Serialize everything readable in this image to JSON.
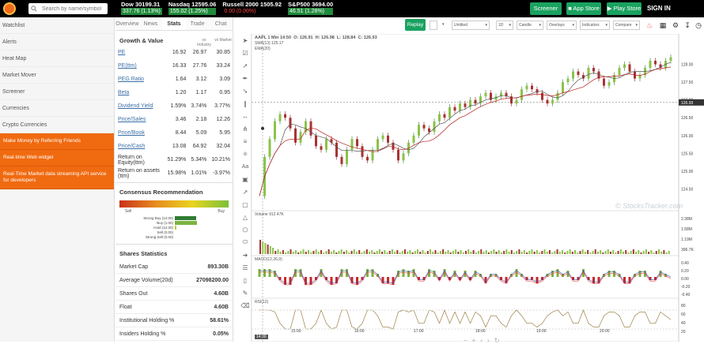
{
  "topbar": {
    "search_placeholder": "Search by name/symbol",
    "tickers": [
      {
        "name": "Dow",
        "value": "30199.31",
        "change": "337.76 (1.13%)",
        "dir": "up"
      },
      {
        "name": "Nasdaq",
        "value": "12595.06",
        "change": "155.02 (1.25%)",
        "dir": "up"
      },
      {
        "name": "Russell 2000",
        "value": "1505.92",
        "change": "0.00 (0.00%)",
        "dir": "ld"
      },
      {
        "name": "S&P500",
        "value": "3694.00",
        "change": "46.51 (1.28%)",
        "dir": "up"
      }
    ],
    "buttons": {
      "screener": "Screener",
      "app_store": "App Store",
      "play_store": "Play Store",
      "sign_in": "SIGN IN"
    }
  },
  "sidebar": {
    "items": [
      "Watchlist",
      "Alerts",
      "Heat Map",
      "Market Mover",
      "Screener",
      "Currencies",
      "Crypto Currencies"
    ],
    "promos": [
      "Make Money by Referring Friends",
      "Real-time Web widget",
      "Real-Time Market data streaming API service for developers"
    ]
  },
  "mid": {
    "tabs": [
      "Overview",
      "News",
      "Stats",
      "Trade",
      "Chat"
    ],
    "active_tab": "Stats",
    "growth": {
      "title": "Growth & Value",
      "col_headers": [
        "vs Industry",
        "vs Market"
      ],
      "rows": [
        {
          "label": "PE",
          "v": "16.92",
          "ind": "26.97",
          "mkt": "30.85",
          "link": true
        },
        {
          "label": "PE(ttm)",
          "v": "16.33",
          "ind": "27.76",
          "mkt": "33.24",
          "link": true
        },
        {
          "label": "PEG Ratio",
          "v": "1.64",
          "ind": "3.12",
          "mkt": "3.09",
          "link": true
        },
        {
          "label": "Beta",
          "v": "1.20",
          "ind": "1.17",
          "mkt": "0.95",
          "link": true
        },
        {
          "label": "Dividend Yield",
          "v": "1.59%",
          "ind": "3.74%",
          "mkt": "3.77%",
          "link": true
        },
        {
          "label": "Price/Sales",
          "v": "3.46",
          "ind": "2.18",
          "mkt": "12.26",
          "link": true
        },
        {
          "label": "Price/Book",
          "v": "8.44",
          "ind": "5.09",
          "mkt": "5.95",
          "link": true
        },
        {
          "label": "Price/Cash",
          "v": "13.08",
          "ind": "64.92",
          "mkt": "32.04",
          "link": true
        },
        {
          "label": "Return on Equity(ttm)",
          "v": "51.29%",
          "ind": "5.34%",
          "mkt": "10.21%",
          "link": false
        },
        {
          "label": "Return on assets (ttm)",
          "v": "15.98%",
          "ind": "1.01%",
          "mkt": "-3.97%",
          "link": false
        }
      ]
    },
    "consensus": {
      "title": "Consensus Recommendation",
      "sell": "Sell",
      "buy": "Buy",
      "rows": [
        {
          "label": "Strong Buy (12.00)",
          "frac": 0.95,
          "color": "#2e7d32"
        },
        {
          "label": "Buy (1.00)",
          "frac": 1.0,
          "color": "#7cb342"
        },
        {
          "label": "Hold (12.00)",
          "frac": 0.08,
          "color": "#c0ca33"
        },
        {
          "label": "Sell (0.00)",
          "frac": 0,
          "color": "#f9a825"
        },
        {
          "label": "Strong Sell (0.00)",
          "frac": 0,
          "color": "#d84315"
        }
      ]
    },
    "shares": {
      "title": "Shares Statistics",
      "rows": [
        {
          "label": "Market Cap",
          "value": "893.30B"
        },
        {
          "label": "Average Volume(20d)",
          "value": "27098200.00"
        },
        {
          "label": "Shares Out",
          "value": "4.60B"
        },
        {
          "label": "Float",
          "value": "4.60B"
        },
        {
          "label": "Institutional Holding %",
          "value": "58.61%"
        },
        {
          "label": "Insiders Holding %",
          "value": "0.05%"
        }
      ]
    }
  },
  "chart_toolbar": {
    "replay": "Replay",
    "dropdowns": [
      "Untitled",
      "1D",
      "Candle",
      "Overlays",
      "Indicators",
      "Compare"
    ],
    "icons": [
      "alert-icon",
      "bar-chart-icon",
      "settings-icon",
      "download-icon",
      "history-icon"
    ]
  },
  "chart_data": {
    "type": "line",
    "title": "AAPL 1 Min 14:50",
    "ohlc": {
      "O": "126.91",
      "H": "126.98",
      "L": "128.84",
      "C": "126.93"
    },
    "indicator_labels": [
      "SMA(13) 125.17",
      "EMA(20)"
    ],
    "volume_label": "Volume 912.47K",
    "macd_label": "MACD(12,26,9)",
    "rsi_label": "RSI(12)",
    "watermark": "© StocksTracker.com",
    "price_ticks": [
      "128.00",
      "127.50",
      "127.00",
      "126.50",
      "126.00",
      "125.50",
      "125.00",
      "124.50"
    ],
    "last_price": "126.93",
    "volume_ticks": [
      "2.38M",
      "1.58M",
      "1.19M",
      "396.7K"
    ],
    "macd_ticks": [
      "0.40",
      "0.20",
      "0.00",
      "-0.20",
      "-0.40"
    ],
    "rsi_ticks": [
      "80",
      "60",
      "40",
      "20"
    ],
    "x_ticks": [
      "15:00",
      "16:00",
      "17:00",
      "18:00",
      "19:00",
      "20:00"
    ],
    "cursor_time": "14:30",
    "ylim": [
      124.2,
      128.3
    ],
    "price_series": [
      124.3,
      125.4,
      125.9,
      126.4,
      126.6,
      126.5,
      126.2,
      125.8,
      126.1,
      126.4,
      126.0,
      125.7,
      125.6,
      125.9,
      125.8,
      125.4,
      125.2,
      125.6,
      125.9,
      125.7,
      125.4,
      125.3,
      125.6,
      125.9,
      126.0,
      125.8,
      125.6,
      125.3,
      125.5,
      125.8,
      126.0,
      126.3,
      126.2,
      126.1,
      126.4,
      126.6,
      126.5,
      126.8,
      126.7,
      126.9,
      126.8,
      127.0,
      126.9,
      127.1,
      127.2,
      127.0,
      127.1,
      127.2,
      127.1,
      126.9,
      127.0,
      127.3,
      127.4,
      127.3,
      127.2,
      127.0,
      126.9,
      127.0,
      127.2,
      127.5,
      127.6,
      127.8,
      127.7,
      127.6,
      127.9,
      127.8,
      127.6,
      127.4,
      127.5,
      127.7,
      127.9,
      128.0,
      127.8,
      127.6,
      127.7,
      127.9,
      128.1,
      128.0,
      127.9,
      128.1,
      128.2
    ]
  }
}
